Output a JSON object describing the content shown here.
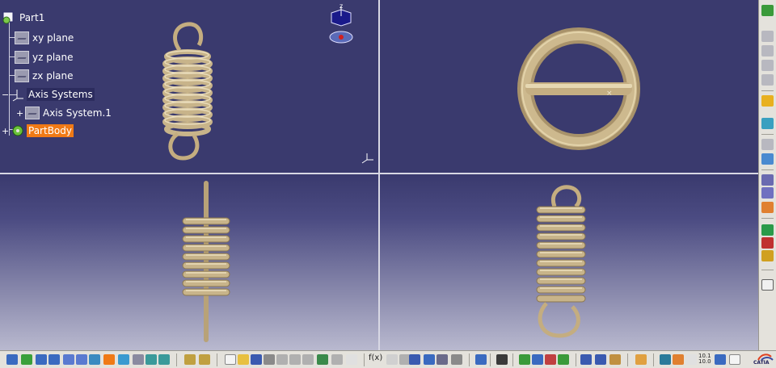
{
  "spec_tree": {
    "root": "Part1",
    "planes": [
      "xy plane",
      "yz plane",
      "zx plane"
    ],
    "axis_systems": "Axis Systems",
    "axis_system_child": "Axis System.1",
    "part_body": "PartBody"
  },
  "viewports": {
    "top_left": "isometric-view",
    "top_right": "top-view",
    "bottom_left": "front-view",
    "bottom_right": "side-view"
  },
  "compass": {
    "axis_label": "z"
  },
  "colors": {
    "background_dark": "#3a3a6e",
    "spring": "#c8b48a",
    "selection": "#f07a16"
  },
  "bottom_toolbar": {
    "fx_label": "f(x)",
    "scale_label": "10.1 10.0"
  },
  "logo": {
    "text": "CATIA"
  }
}
